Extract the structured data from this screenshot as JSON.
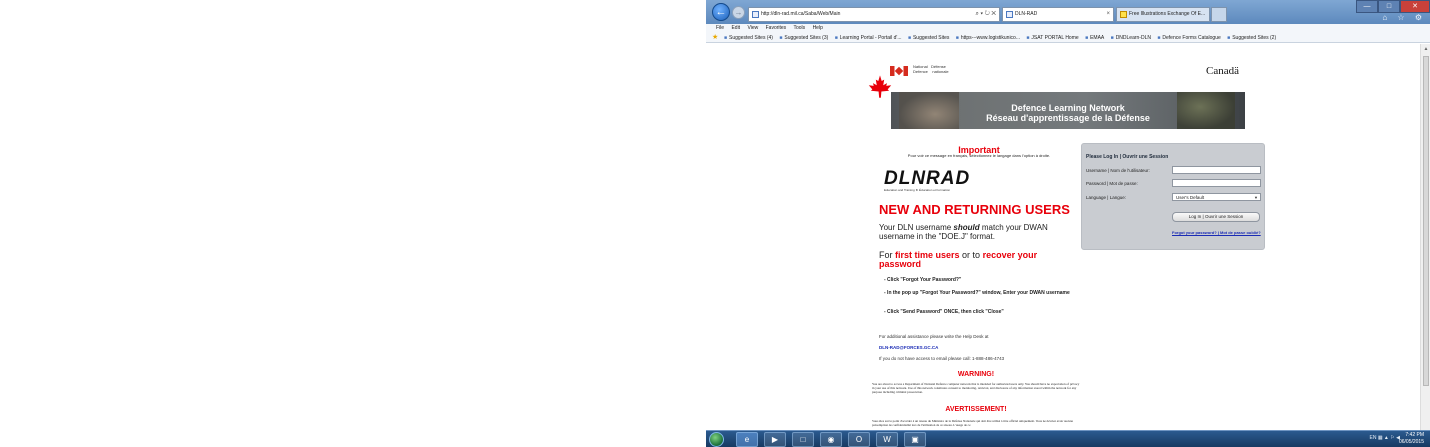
{
  "browser": {
    "url": "http://dln-rad.mil.ca/Saba/Web/Main",
    "address_tools": "⌕ ▾ ↻ ✕",
    "tabs": [
      {
        "title": "DLN-RAD"
      },
      {
        "title": "Free Illustrations Exchange Of E..."
      }
    ],
    "tab_close": "×",
    "window_buttons": {
      "minimize": "—",
      "maximize": "□",
      "close": "✕"
    },
    "right_icons": "⌂ ☆ ⚙",
    "menu": [
      "File",
      "Edit",
      "View",
      "Favorites",
      "Tools",
      "Help"
    ],
    "favorites": [
      "Suggested Sites (4)",
      "Suggested Sites (3)",
      "Learning Portal - Portail d'...",
      "Suggested Sites",
      "https---www.logistikunico...",
      "JSAT PORTAL Home",
      "EMAA",
      "DNDLearn-DLN",
      "Defence Forms Catalogue",
      "Suggested Sites (2)"
    ]
  },
  "page": {
    "dept_name": "National   Défense\nDefence    nationale",
    "canada_wordmark": "Canadä",
    "banner_line1": "Defence Learning Network",
    "banner_line2": "Réseau d'apprentissage de la Défense",
    "important_title": "Important",
    "important_sub": "Pour voir ce message en français, sélectionnez le langage dans l'option à droite.",
    "logo_text": "DLNRAD",
    "logo_tagline": "Education and Training  ★  Éducation et Formation",
    "new_users_heading": "NEW AND RETURNING USERS",
    "username_pre": "Your DLN username ",
    "username_emph": "should",
    "username_post": " match your DWAN username in the \"DOE.J\" format.",
    "first_time_pre": "For ",
    "first_time_mid1": "first time users",
    "first_time_or": " or to ",
    "first_time_mid2": "recover your password",
    "steps": [
      "- Click \"Forgot Your Password?\"",
      "- In the pop up \"Forgot Your Password?\" window, Enter your DWAN username",
      "- Click \"Send Password\" ONCE, then click \"Close\""
    ],
    "help_line": "For additional assistance please write the Help Desk at",
    "help_email": "DLN-RAD@FORCES.GC.CA",
    "help_phone": "If you do not have access to email please call: 1-888-486-4743",
    "warning_title": "WARNING!",
    "warning_text": "You are about to access a Department of National Defence computer network that is intended for authorized users only. You should have no expectation of privacy in your use of this network. Use of this network constitutes consent to monitoring, retrieval, and disclosure of any information stored within the network for any purpose including criminal prosecution.",
    "avert_title": "AVERTISSEMENT!",
    "avert_text": "Vous êtes sur le point d'accéder à un réseau du Ministère de la Défense Nationale qui doit être utilisé à titre officiel uniquement. Vous ne devriez avoir aucune présomption de confidentialité lors de l'utilisation de ce réseau. L'usage de ce"
  },
  "login": {
    "title": "Please Log In | Ouvrir une Session",
    "username_label": "Username | Nom de l'utilisateur:",
    "password_label": "Password | Mot de passe:",
    "language_label": "Language | Langue:",
    "language_value": "User's Default",
    "button_label": "Log In | Ouvrir une Session",
    "forgot_link": "Forgot your password? | Mot de passe oublié?"
  },
  "taskbar": {
    "tray": "EN ▦ ▲ ⚐ ◀",
    "time": "7:42 PM",
    "date": "06/05/2015"
  },
  "colors": {
    "accent_red": "#e8000b",
    "link_blue": "#1a2bb5",
    "login_panel": "#c9ccd1"
  }
}
